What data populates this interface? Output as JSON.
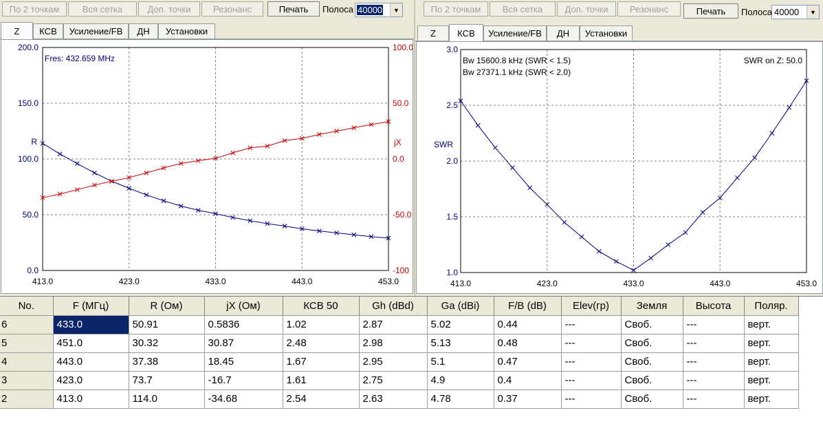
{
  "left_toolbar": {
    "buttons": [
      "По 2 точкам",
      "Вся сетка",
      "Доп. точки",
      "Резонанс",
      "Печать"
    ],
    "band_label": "Полоса",
    "band_value": "40000"
  },
  "right_toolbar": {
    "buttons": [
      "По 2 точкам",
      "Вся сетка",
      "Доп. точки",
      "Резонанс",
      "Печать"
    ],
    "band_label": "Полоса",
    "band_value": "40000"
  },
  "left_tabs": [
    "Z",
    "КСВ",
    "Усиление/FB",
    "ДН",
    "Установки"
  ],
  "right_tabs": [
    "Z",
    "КСВ",
    "Усиление/FB",
    "ДН",
    "Установки"
  ],
  "colors": {
    "r_series": "#000080",
    "jx_series": "#cc0000",
    "selection": "#0a246a"
  },
  "chart_data": [
    {
      "type": "line",
      "annotation": "Fres: 432.659 MHz",
      "xlim": [
        413,
        453
      ],
      "x_ticks": [
        "413.0",
        "423.0",
        "433.0",
        "443.0",
        "453.0"
      ],
      "left_axis": {
        "label": "R",
        "ylim": [
          0,
          200
        ],
        "ticks": [
          "0.0",
          "50.0",
          "100.0",
          "150.0",
          "200.0"
        ]
      },
      "right_axis": {
        "label": "jX",
        "ylim": [
          -100,
          100
        ],
        "ticks": [
          "-100",
          "-50.0",
          "0.0",
          "50.0",
          "100.0"
        ]
      },
      "grid": true,
      "series": [
        {
          "name": "R",
          "axis": "left",
          "x": [
            413,
            415,
            417,
            419,
            421,
            423,
            425,
            427,
            429,
            431,
            433,
            435,
            437,
            439,
            441,
            443,
            445,
            447,
            449,
            451,
            453
          ],
          "y": [
            114.0,
            104.5,
            95.9,
            87.5,
            80.0,
            73.7,
            67.8,
            62.5,
            57.8,
            54.0,
            50.91,
            47.5,
            44.6,
            42.0,
            39.8,
            37.38,
            35.4,
            33.7,
            32.0,
            30.32,
            29.0
          ]
        },
        {
          "name": "jX",
          "axis": "right",
          "x": [
            413,
            415,
            417,
            419,
            421,
            423,
            425,
            427,
            429,
            431,
            433,
            435,
            437,
            439,
            441,
            443,
            445,
            447,
            449,
            451,
            453
          ],
          "y": [
            -34.68,
            -31.5,
            -27.5,
            -23.5,
            -20.0,
            -16.7,
            -12.5,
            -8.0,
            -4.0,
            -1.5,
            0.5836,
            5.5,
            10.0,
            11.5,
            16.5,
            18.45,
            22.0,
            25.0,
            28.0,
            30.87,
            33.5
          ]
        }
      ]
    },
    {
      "type": "line",
      "annotations": [
        "Bw 15600.8 kHz (SWR < 1.5)",
        "Bw 27371.1 kHz (SWR < 2.0)",
        "SWR on Z: 50.0"
      ],
      "ylabel": "SWR",
      "xlim": [
        413,
        453
      ],
      "ylim": [
        1.0,
        3.0
      ],
      "x_ticks": [
        "413.0",
        "423.0",
        "433.0",
        "443.0",
        "453.0"
      ],
      "y_ticks": [
        "1.0",
        "1.5",
        "2.0",
        "2.5",
        "3.0"
      ],
      "grid": true,
      "series": [
        {
          "name": "SWR",
          "x": [
            413,
            415,
            417,
            419,
            421,
            423,
            425,
            427,
            429,
            431,
            433,
            435,
            437,
            439,
            441,
            443,
            445,
            447,
            449,
            451,
            453
          ],
          "y": [
            2.54,
            2.32,
            2.12,
            1.94,
            1.76,
            1.61,
            1.45,
            1.32,
            1.19,
            1.1,
            1.02,
            1.13,
            1.25,
            1.36,
            1.54,
            1.67,
            1.85,
            2.03,
            2.25,
            2.48,
            2.72
          ]
        }
      ]
    }
  ],
  "table": {
    "headers": [
      "No.",
      "F (МГц)",
      "R (Ом)",
      "jX (Ом)",
      "КСВ 50",
      "Gh (dBd)",
      "Ga (dBi)",
      "F/B (dB)",
      "Elev(гр)",
      "Земля",
      "Высота",
      "Поляр."
    ],
    "rows": [
      [
        "6",
        "433.0",
        "50.91",
        "0.5836",
        "1.02",
        "2.87",
        "5.02",
        "0.44",
        "---",
        "Своб.",
        "---",
        "верт."
      ],
      [
        "5",
        "451.0",
        "30.32",
        "30.87",
        "2.48",
        "2.98",
        "5.13",
        "0.48",
        "---",
        "Своб.",
        "---",
        "верт."
      ],
      [
        "4",
        "443.0",
        "37.38",
        "18.45",
        "1.67",
        "2.95",
        "5.1",
        "0.47",
        "---",
        "Своб.",
        "---",
        "верт."
      ],
      [
        "3",
        "423.0",
        "73.7",
        "-16.7",
        "1.61",
        "2.75",
        "4.9",
        "0.4",
        "---",
        "Своб.",
        "---",
        "верт."
      ],
      [
        "2",
        "413.0",
        "114.0",
        "-34.68",
        "2.54",
        "2.63",
        "4.78",
        "0.37",
        "---",
        "Своб.",
        "---",
        "верт."
      ]
    ]
  }
}
